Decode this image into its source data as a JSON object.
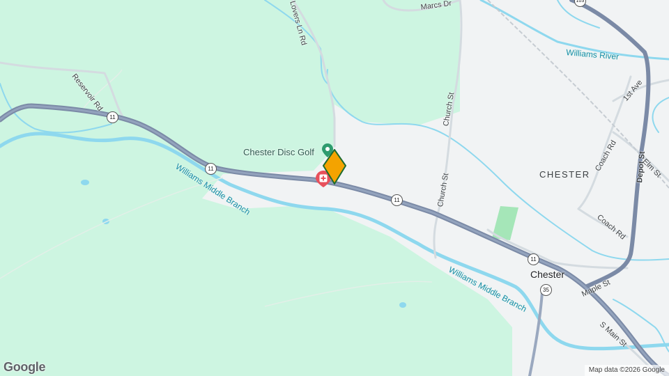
{
  "map": {
    "place_label": "Chester",
    "area_label": "CHESTER",
    "poi": {
      "name": "Chester Disc Golf",
      "icon": "park-pin-icon"
    },
    "hospital_icon": "hospital-icon",
    "marker": {
      "icon": "location-marker-icon",
      "color": "#f4a300"
    },
    "roads": {
      "marcs_dr": "Marcs Dr",
      "lovers_ln_rd": "Lovers Ln Rd",
      "reservoir_rd": "Reservoir Rd",
      "church_st_1": "Church St",
      "church_st_2": "Church St",
      "first_ave": "1st Ave",
      "coach_rd_1": "Coach Rd",
      "coach_rd_2": "Coach Rd",
      "elm_st": "Elm St",
      "depot_st": "Depot St",
      "maple_st": "Maple St",
      "s_main_st": "S Main St"
    },
    "water": {
      "williams_river": "Williams River",
      "middle_branch_1": "Williams Middle Branch",
      "middle_branch_2": "Williams Middle Branch"
    },
    "shields": {
      "route_11_a": "11",
      "route_11_b": "11",
      "route_11_c": "11",
      "route_11_d": "11",
      "route_35": "35",
      "route_103": "103"
    },
    "colors": {
      "forest": "#cdf5e1",
      "urban": "#f1f3f4",
      "water": "#8ed8ee",
      "highway": "#8596b3",
      "park": "#a5e6b8"
    }
  },
  "branding": {
    "logo": "Google",
    "attribution": "Map data ©2026 Google"
  }
}
